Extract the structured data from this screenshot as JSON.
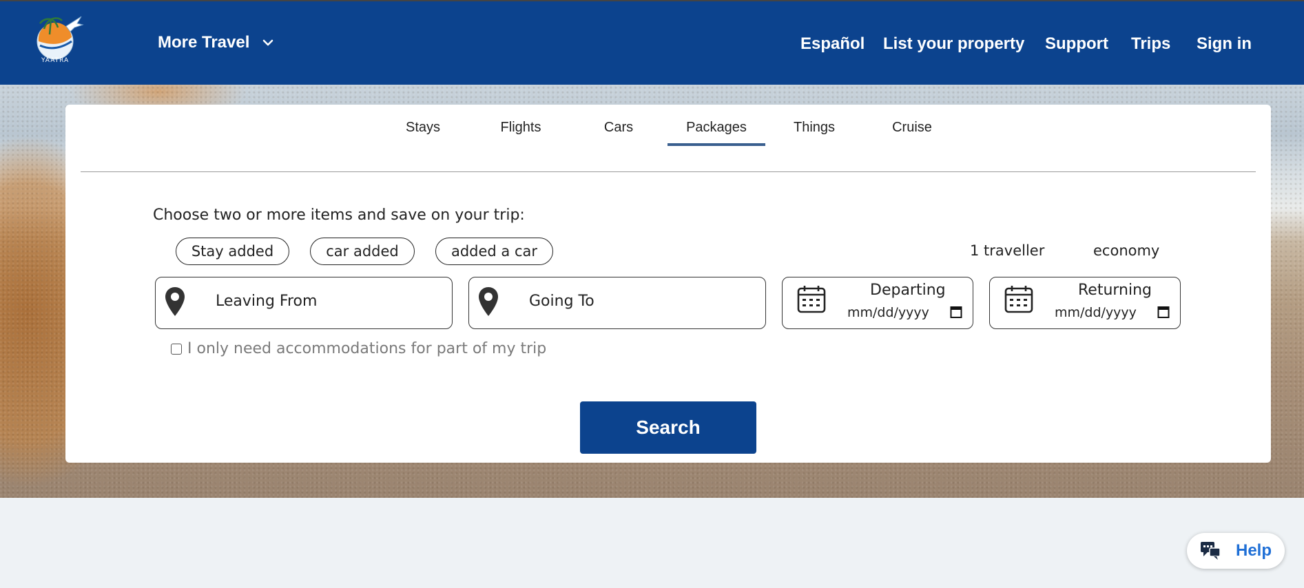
{
  "header": {
    "logo_text": "YAATRA",
    "more_travel": "More Travel",
    "nav": [
      "Español",
      "List your property",
      "Support",
      "Trips",
      "Sign in"
    ]
  },
  "tabs": [
    {
      "label": "Stays",
      "active": false
    },
    {
      "label": "Flights",
      "active": false
    },
    {
      "label": "Cars",
      "active": false
    },
    {
      "label": "Packages",
      "active": true
    },
    {
      "label": "Things",
      "active": false
    },
    {
      "label": "Cruise",
      "active": false
    }
  ],
  "form": {
    "prompt": "Choose two or more items and save on your trip:",
    "pills": [
      "Stay added",
      "car added",
      "added a car"
    ],
    "traveller": "1 traveller",
    "class": "economy",
    "leaving_from": "Leaving From",
    "going_to": "Going To",
    "departing_label": "Departing",
    "returning_label": "Returning",
    "date_placeholder": "mm/dd/yyyy",
    "partial_accommodation": "I only need accommodations for part of my trip",
    "search": "Search"
  },
  "help": {
    "label": "Help"
  },
  "colors": {
    "brand_blue": "#0c438e",
    "help_blue": "#1f6fd6",
    "tab_underline": "#3a5f8f"
  }
}
